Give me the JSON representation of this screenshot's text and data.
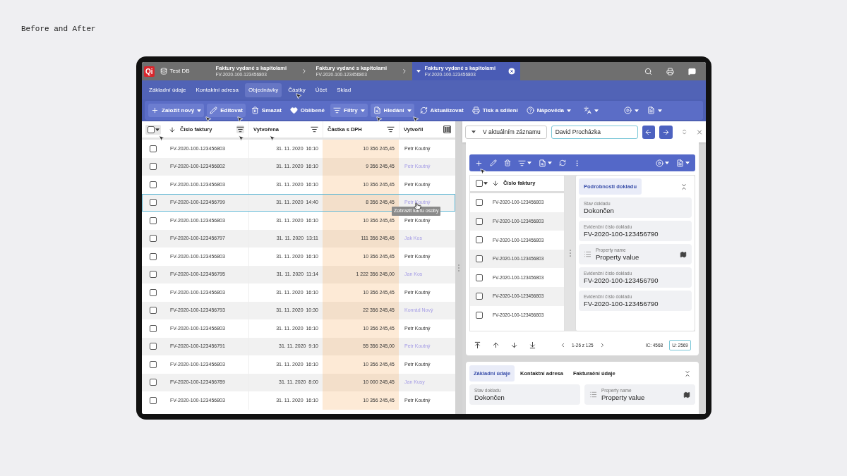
{
  "caption": "Before and After",
  "logo": "Qi",
  "database": "Test DB",
  "doc_tabs": [
    {
      "title": "Faktury vydané s kapitolami",
      "subtitle": "FV-2020-100-123456803",
      "selected": false
    },
    {
      "title": "Faktury vydané s kapitolami",
      "subtitle": "FV-2020-100-123456803",
      "selected": false
    },
    {
      "title": "Faktury vydané s kapitolami",
      "subtitle": "FV-2020-100-123456803",
      "selected": true
    }
  ],
  "section_tabs": [
    {
      "label": "Základní údaje",
      "selected": false
    },
    {
      "label": "Kontaktní adresa",
      "selected": false
    },
    {
      "label": "Objednávky",
      "selected": true
    },
    {
      "label": "Částky",
      "selected": false
    },
    {
      "label": "Účet",
      "selected": false
    },
    {
      "label": "Sklad",
      "selected": false
    }
  ],
  "toolbar": [
    {
      "kind": "labeled",
      "label": "Založit nový",
      "highlighted": true,
      "dropdown": true
    },
    {
      "kind": "labeled",
      "label": "Editovat",
      "highlighted": true,
      "dropdown": false
    },
    {
      "kind": "labeled",
      "label": "Smazat",
      "highlighted": false,
      "dropdown": false
    },
    {
      "kind": "labeled",
      "label": "Oblíbené",
      "highlighted": false,
      "dropdown": false
    },
    {
      "kind": "labeled",
      "label": "Filtry",
      "highlighted": true,
      "dropdown": true
    },
    {
      "kind": "labeled",
      "label": "Hledání",
      "highlighted": true,
      "dropdown": true
    },
    {
      "kind": "labeled",
      "label": "Aktualizovat",
      "highlighted": false,
      "dropdown": false
    },
    {
      "kind": "labeled",
      "label": "Tisk a sdílení",
      "highlighted": false,
      "dropdown": false
    },
    {
      "kind": "labeled",
      "label": "Nápověda",
      "highlighted": false,
      "dropdown": true
    },
    {
      "kind": "icon",
      "highlighted": false,
      "dropdown": true
    },
    {
      "kind": "icon",
      "highlighted": false,
      "dropdown": true
    },
    {
      "kind": "icon",
      "highlighted": false,
      "dropdown": true
    }
  ],
  "table": {
    "select_all": {
      "checked": false
    },
    "columns": [
      {
        "label": "Číslo faktury",
        "sorted": true
      },
      {
        "label": "Vytvořena",
        "sorted": false
      },
      {
        "label": "Částka s DPH",
        "sorted": false
      },
      {
        "label": "Vytvořil",
        "sorted": false
      }
    ],
    "rows": [
      {
        "number": "FV-2020-100-123456803",
        "created": "31. 11. 2020  16:10",
        "amount": "10 356 245,45",
        "author": "Petr Koutný",
        "link": false,
        "checked": false,
        "selected": false
      },
      {
        "number": "FV-2020-100-123456802",
        "created": "31. 11. 2020  16:10",
        "amount": "9 356 245,45",
        "author": "Petr Koutný",
        "link": true,
        "checked": false,
        "selected": false
      },
      {
        "number": "FV-2020-100-123456803",
        "created": "31. 11. 2020  16:10",
        "amount": "10 356 245,45",
        "author": "Petr Koutný",
        "link": false,
        "checked": false,
        "selected": false
      },
      {
        "number": "FV-2020-100-123456799",
        "created": "31. 11. 2020  14:40",
        "amount": "8 356 245,45",
        "author": "Petr Koutný",
        "link": true,
        "checked": false,
        "selected": true,
        "tooltip": "Zobrazit kartu osoby"
      },
      {
        "number": "FV-2020-100-123456803",
        "created": "31. 11. 2020  16:10",
        "amount": "10 356 245,45",
        "author": "Petr Koutný",
        "link": false,
        "checked": false,
        "selected": false
      },
      {
        "number": "FV-2020-100-123456797",
        "created": "31. 11. 2020  13:11",
        "amount": "111 356 245,45",
        "author": "Jak Kos",
        "link": true,
        "checked": false,
        "selected": false
      },
      {
        "number": "FV-2020-100-123456803",
        "created": "31. 11. 2020  16:10",
        "amount": "10 356 245,45",
        "author": "Petr Koutný",
        "link": false,
        "checked": false,
        "selected": false
      },
      {
        "number": "FV-2020-100-123456795",
        "created": "31. 11. 2020  11:14",
        "amount": "1 222 356 245,00",
        "author": "Jan Kos",
        "link": true,
        "checked": false,
        "selected": false
      },
      {
        "number": "FV-2020-100-123456803",
        "created": "31. 11. 2020  16:10",
        "amount": "10 356 245,45",
        "author": "Petr Koutný",
        "link": false,
        "checked": false,
        "selected": false
      },
      {
        "number": "FV-2020-100-123456793",
        "created": "31. 11. 2020  10:30",
        "amount": "22 356 245,45",
        "author": "Konrád Nový",
        "link": true,
        "checked": false,
        "selected": false
      },
      {
        "number": "FV-2020-100-123456803",
        "created": "31. 11. 2020  16:10",
        "amount": "10 356 245,45",
        "author": "Petr Koutný",
        "link": false,
        "checked": false,
        "selected": false
      },
      {
        "number": "FV-2020-100-123456791",
        "created": "31. 11. 2020  9:10",
        "amount": "55 356 245,00",
        "author": "Petr Koutný",
        "link": true,
        "checked": false,
        "selected": false
      },
      {
        "number": "FV-2020-100-123456803",
        "created": "31. 11. 2020  16:10",
        "amount": "10 356 245,45",
        "author": "Petr Koutný",
        "link": false,
        "checked": false,
        "selected": false
      },
      {
        "number": "FV-2020-100-123456789",
        "created": "31. 11. 2020  8:00",
        "amount": "10 000 245,45",
        "author": "Jan Kusy",
        "link": true,
        "checked": false,
        "selected": false
      },
      {
        "number": "FV-2020-100-123456803",
        "created": "31. 11. 2020  16:10",
        "amount": "10 356 245,45",
        "author": "Petr Koutný",
        "link": false,
        "checked": false,
        "selected": false
      }
    ]
  },
  "search_bar": {
    "scope": "V aktuálním záznamu",
    "value": "David Procházka"
  },
  "detail": {
    "list": {
      "select_all": {
        "checked": false
      },
      "column": "Číslo faktury",
      "rows": [
        {
          "number": "FV-2020-100-123456803",
          "checked": false
        },
        {
          "number": "FV-2020-100-123456803",
          "checked": false
        },
        {
          "number": "FV-2020-100-123456803",
          "checked": false
        },
        {
          "number": "FV-2020-100-123456803",
          "checked": false
        },
        {
          "number": "FV-2020-100-123456803",
          "checked": false
        },
        {
          "number": "FV-2020-100-123456803",
          "checked": false
        },
        {
          "number": "FV-2020-100-123456803",
          "checked": false
        }
      ]
    },
    "panel": {
      "title": "Podrobnosti dokladu",
      "fields": [
        {
          "kind": "text",
          "label": "Stav dokladu",
          "value": "Dokončen"
        },
        {
          "kind": "text",
          "label": "Evidenční číslo dokladu",
          "value": "FV-2020-100-123456790"
        },
        {
          "kind": "property",
          "label": "Property name",
          "value": "Property value"
        },
        {
          "kind": "text",
          "label": "Evidenční číslo dokladu",
          "value": "FV-2020-100-123456790"
        },
        {
          "kind": "text",
          "label": "Evidenční číslo dokladu",
          "value": "FV-2020-100-123456790"
        }
      ]
    },
    "pager": {
      "range": "1-26 z 125",
      "ic": "IC: 4568",
      "u": "U: 2569"
    }
  },
  "bottom_card": {
    "tabs": [
      {
        "label": "Základní údaje",
        "selected": true
      },
      {
        "label": "Kontaktní adresa",
        "selected": false
      },
      {
        "label": "Fakturační údaje",
        "selected": false
      }
    ],
    "fields": [
      {
        "kind": "text",
        "label": "Stav dokladu",
        "value": "Dokončen"
      },
      {
        "kind": "property",
        "label": "Property name",
        "value": "Property value"
      }
    ]
  }
}
